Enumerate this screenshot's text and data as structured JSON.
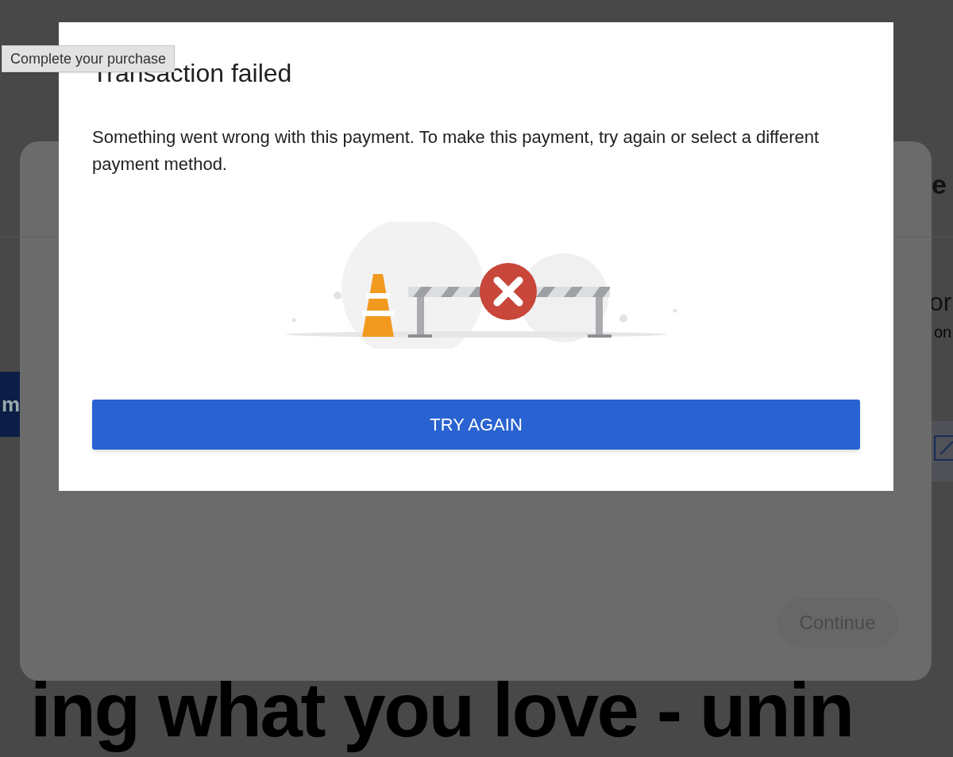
{
  "background_page": {
    "button_fragment": "m",
    "heading_fragment": "e",
    "title_fragment": "or",
    "subtitle_fragment": "on",
    "headline": "ing what you love - unin"
  },
  "background_dialog": {
    "continue_button": {
      "label": "Continue",
      "disabled": true
    }
  },
  "dialog": {
    "title": "Transaction failed",
    "message": "Something went wrong with this payment. To make this payment, try again or select a different payment method.",
    "button": "TRY AGAIN"
  },
  "tooltip": {
    "text": "Complete your purchase"
  }
}
